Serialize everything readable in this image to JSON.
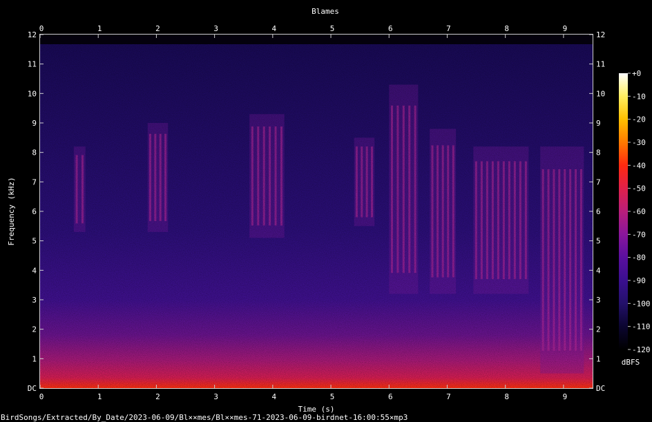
{
  "chart_data": {
    "type": "heatmap",
    "title": "Blames",
    "xlabel": "Time (s)",
    "ylabel": "Frequency (kHz)",
    "xlim": [
      0,
      9.5
    ],
    "ylim": [
      0,
      12
    ],
    "x_ticks": [
      "0",
      "1",
      "2",
      "3",
      "4",
      "5",
      "6",
      "7",
      "8",
      "9"
    ],
    "y_ticks": [
      "DC",
      "1",
      "2",
      "3",
      "4",
      "5",
      "6",
      "7",
      "8",
      "9",
      "10",
      "11",
      "12"
    ],
    "colorbar": {
      "label": "dBFS",
      "ticks": [
        "+0",
        "-10",
        "-20",
        "-30",
        "-40",
        "-50",
        "-60",
        "-70",
        "-80",
        "-90",
        "-100",
        "-110",
        "-120"
      ],
      "range": [
        -120,
        0
      ],
      "colors": [
        "#000000",
        "#0b0530",
        "#23106a",
        "#3a0f8f",
        "#5a0f9f",
        "#8a169c",
        "#b91e7a",
        "#e0204a",
        "#ff2a10",
        "#ff7a00",
        "#ffc000",
        "#ffee60",
        "#ffffff"
      ]
    },
    "call_bursts": [
      {
        "t_start": 0.58,
        "t_end": 0.78,
        "f_low": 5.3,
        "f_high": 8.2
      },
      {
        "t_start": 1.85,
        "t_end": 2.2,
        "f_low": 5.3,
        "f_high": 9.0
      },
      {
        "t_start": 3.6,
        "t_end": 4.2,
        "f_low": 5.1,
        "f_high": 9.3
      },
      {
        "t_start": 5.4,
        "t_end": 5.75,
        "f_low": 5.5,
        "f_high": 8.5
      },
      {
        "t_start": 6.0,
        "t_end": 6.5,
        "f_low": 3.2,
        "f_high": 10.3
      },
      {
        "t_start": 6.7,
        "t_end": 7.15,
        "f_low": 3.2,
        "f_high": 8.8
      },
      {
        "t_start": 7.45,
        "t_end": 8.4,
        "f_low": 3.2,
        "f_high": 8.2
      },
      {
        "t_start": 8.6,
        "t_end": 9.35,
        "f_low": 0.5,
        "f_high": 8.2
      }
    ]
  },
  "footer": {
    "filename": "BirdSongs/Extracted/By_Date/2023-06-09/Bl××mes/Bl××mes-71-2023-06-09-birdnet-16:00:55×mp3"
  }
}
